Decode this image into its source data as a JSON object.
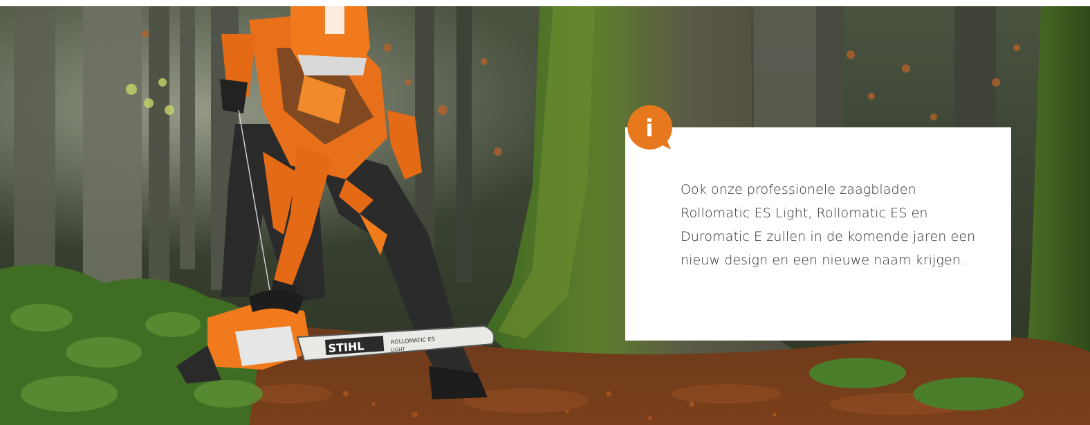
{
  "hero": {
    "image_alt": "Forestry worker in orange STIHL protective gear starting a chainsaw in an autumn forest",
    "brand_on_bar": "STIHL",
    "bar_model": "ROLLOMATIC ES",
    "bar_sub": "LIGHT"
  },
  "info_box": {
    "icon_glyph": "i",
    "icon_name": "info-icon",
    "text": "Ook onze professionele zaagbladen Rollomatic ES Light, Rollomatic ES en Duromatic E zullen in de komende jaren een nieuw design en een nieuwe naam krijgen."
  },
  "colors": {
    "accent": "#e8781e",
    "card": "#ffffff",
    "text": "#2a2a2a"
  }
}
